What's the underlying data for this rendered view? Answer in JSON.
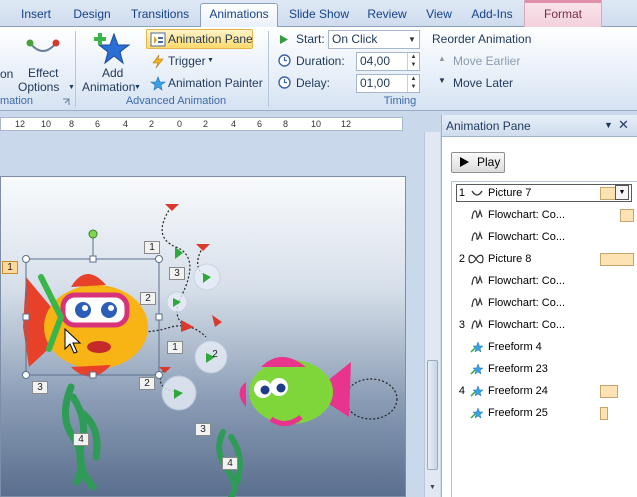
{
  "tabs": [
    {
      "label": "Insert",
      "active": false
    },
    {
      "label": "Design",
      "active": false
    },
    {
      "label": "Transitions",
      "active": false
    },
    {
      "label": "Animations",
      "active": true
    },
    {
      "label": "Slide Show",
      "active": false
    },
    {
      "label": "Review",
      "active": false
    },
    {
      "label": "View",
      "active": false
    },
    {
      "label": "Add-Ins",
      "active": false
    },
    {
      "label": "Format",
      "active": false
    }
  ],
  "ribbon": {
    "partial_label_1": "on",
    "effect_options_line1": "Effect",
    "effect_options_line2": "Options",
    "partial_group_label": "mation",
    "add_animation_line1": "Add",
    "add_animation_line2": "Animation",
    "animation_pane": "Animation Pane",
    "trigger": "Trigger",
    "animation_painter": "Animation Painter",
    "advanced_group_label": "Advanced Animation",
    "start_label": "Start:",
    "start_value": "On Click",
    "duration_label": "Duration:",
    "duration_value": "04,00",
    "delay_label": "Delay:",
    "delay_value": "01,00",
    "timing_group_label": "Timing",
    "reorder_title": "Reorder Animation",
    "move_earlier": "Move Earlier",
    "move_later": "Move Later"
  },
  "ruler": {
    "ticks": [
      "12",
      "10",
      "8",
      "6",
      "4",
      "2",
      "0",
      "2",
      "4",
      "6",
      "8",
      "10",
      "12"
    ]
  },
  "slide": {
    "badges": [
      "1",
      "1",
      "3",
      "2",
      "1",
      "2",
      "3",
      "2",
      "4",
      "3",
      "4"
    ]
  },
  "pane": {
    "title": "Animation Pane",
    "play_label": "Play",
    "rows": [
      {
        "num": "1",
        "name": "Picture 7",
        "icon": "path-icon"
      },
      {
        "num": "",
        "name": "Flowchart: Co...",
        "icon": "zigzag-icon"
      },
      {
        "num": "",
        "name": "Flowchart: Co...",
        "icon": "zigzag-icon"
      },
      {
        "num": "2",
        "name": "Picture 8",
        "icon": "infinity-icon"
      },
      {
        "num": "",
        "name": "Flowchart: Co...",
        "icon": "zigzag-icon"
      },
      {
        "num": "",
        "name": "Flowchart: Co...",
        "icon": "zigzag-icon"
      },
      {
        "num": "3",
        "name": "Flowchart: Co...",
        "icon": "zigzag-icon"
      },
      {
        "num": "",
        "name": "Freeform 4",
        "icon": "star-icon"
      },
      {
        "num": "",
        "name": "Freeform 23",
        "icon": "star-icon"
      },
      {
        "num": "4",
        "name": "Freeform 24",
        "icon": "star-icon"
      },
      {
        "num": "",
        "name": "Freeform 25",
        "icon": "star-icon"
      }
    ]
  },
  "colors": {
    "accent": "#15428b",
    "timing_bar": "#fde3b3",
    "selected_badge": "#ffd89a"
  }
}
